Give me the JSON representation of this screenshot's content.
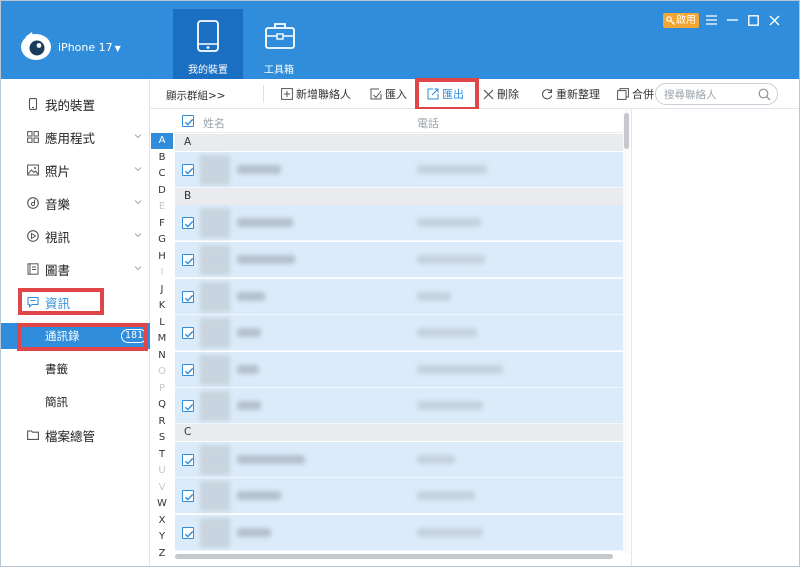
{
  "colors": {
    "header": "#2f8ddb",
    "accent": "#2f8ddb",
    "highlight": "#e0454a",
    "badge": "#f2a531",
    "row_selected": "#dcebf9"
  },
  "header": {
    "device_name": "iPhone 17",
    "tabs": [
      {
        "label": "我的裝置",
        "icon": "phone-icon"
      },
      {
        "label": "工具箱",
        "icon": "toolbox-icon"
      }
    ],
    "enable_label": "啟用"
  },
  "sidebar": {
    "items": [
      {
        "label": "我的裝置",
        "icon": "device-icon"
      },
      {
        "label": "應用程式",
        "icon": "apps-icon"
      },
      {
        "label": "照片",
        "icon": "photo-icon"
      },
      {
        "label": "音樂",
        "icon": "music-icon"
      },
      {
        "label": "視訊",
        "icon": "video-icon"
      },
      {
        "label": "圖書",
        "icon": "book-icon"
      },
      {
        "label": "資訊",
        "icon": "info-icon"
      },
      {
        "label": "檔案總管",
        "icon": "folder-icon"
      }
    ],
    "sub_items": [
      {
        "label": "通訊錄",
        "count": "181"
      },
      {
        "label": "書籤"
      },
      {
        "label": "簡訊"
      }
    ]
  },
  "toolbar": {
    "show_groups": "顯示群組>>",
    "buttons": [
      {
        "label": "新增聯絡人",
        "icon": "add-icon"
      },
      {
        "label": "匯入",
        "icon": "import-icon"
      },
      {
        "label": "匯出",
        "icon": "export-icon"
      },
      {
        "label": "刪除",
        "icon": "delete-icon"
      },
      {
        "label": "重新整理",
        "icon": "refresh-icon"
      },
      {
        "label": "合併",
        "icon": "merge-icon"
      }
    ],
    "search_placeholder": "搜尋聯絡人"
  },
  "alphabet": [
    "A",
    "B",
    "C",
    "D",
    "E",
    "F",
    "G",
    "H",
    "I",
    "J",
    "K",
    "L",
    "M",
    "N",
    "O",
    "P",
    "Q",
    "R",
    "S",
    "T",
    "U",
    "V",
    "W",
    "X",
    "Y",
    "Z"
  ],
  "alphabet_active": "A",
  "alphabet_dim": [
    "E",
    "I",
    "O",
    "P",
    "U",
    "V"
  ],
  "table": {
    "columns": [
      "姓名",
      "電話"
    ],
    "groups": [
      "A",
      "B",
      "C"
    ]
  }
}
